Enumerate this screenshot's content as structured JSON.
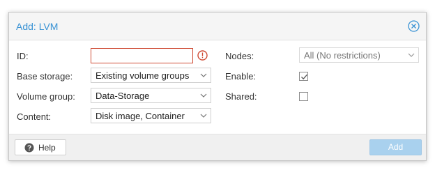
{
  "dialog": {
    "title": "Add: LVM",
    "close_icon": "close-circle-icon"
  },
  "form": {
    "id_label": "ID:",
    "id_value": "",
    "id_error_icon": "error-circle-icon",
    "base_storage_label": "Base storage:",
    "base_storage_value": "Existing volume groups",
    "volume_group_label": "Volume group:",
    "volume_group_value": "Data-Storage",
    "content_label": "Content:",
    "content_value": "Disk image, Container",
    "nodes_label": "Nodes:",
    "nodes_value": "All (No restrictions)",
    "enable_label": "Enable:",
    "enable_checked": true,
    "shared_label": "Shared:",
    "shared_checked": false
  },
  "footer": {
    "help_label": "Help",
    "help_icon": "question-circle-icon",
    "add_label": "Add"
  },
  "colors": {
    "accent": "#3892d4",
    "error": "#cf4c35",
    "add_button_disabled": "#a9d1ee"
  }
}
